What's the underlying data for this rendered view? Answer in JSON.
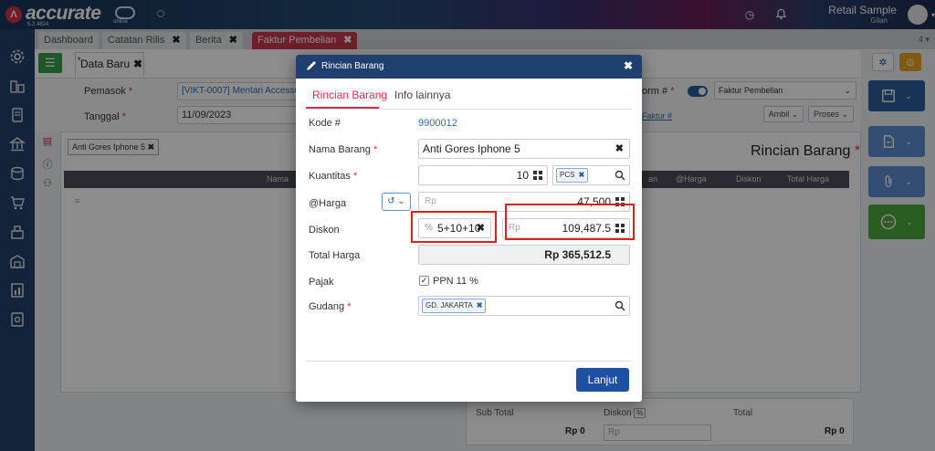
{
  "topbar": {
    "logo": "accurate",
    "logo_sub": "online",
    "version": "5.2.4824",
    "user_name": "Retail Sample",
    "user_sub": "Gilan"
  },
  "tabs": [
    {
      "label": "Dashboard"
    },
    {
      "label": "Catatan Rilis",
      "close": "✖"
    },
    {
      "label": "Berita",
      "close": "✖"
    },
    {
      "label": "Faktur Pembelian",
      "close": "✖",
      "active": true
    }
  ],
  "tab_count": "4",
  "subtab": {
    "label": "Data Baru",
    "close": "✖"
  },
  "form": {
    "pemasok_label": "Pemasok",
    "pemasok_value": "[VIKT-0007] Mentari Accessories",
    "tanggal_label": "Tanggal",
    "tanggal_value": "11/09/2023",
    "form_label": "orm #",
    "form_value": "Faktur Pembelian",
    "faktur_link": "Faktur #",
    "ambil_label": "Ambil",
    "proses_label": "Proses"
  },
  "detail": {
    "title": "Rincian Barang",
    "chip": "Anti Gores Iphone 5",
    "columns": [
      "Nama",
      "an",
      "@Harga",
      "Diskon",
      "Total Harga"
    ]
  },
  "totals": {
    "subtotal_label": "Sub Total",
    "subtotal_value": "Rp 0",
    "diskon_label": "Diskon",
    "diskon_rp": "Rp",
    "total_label": "Total",
    "total_value": "Rp 0"
  },
  "modal": {
    "title": "Rincian Barang",
    "close": "✖",
    "tabs": [
      {
        "label": "Rincian Barang"
      },
      {
        "label": "Info lainnya"
      }
    ],
    "kode_label": "Kode #",
    "kode_value": "9900012",
    "nama_label": "Nama Barang",
    "nama_value": "Anti Gores Iphone 5",
    "kuantitas_label": "Kuantitas",
    "kuantitas_value": "10",
    "unit_chip": "PCS",
    "harga_label": "@Harga",
    "harga_prefix": "Rp",
    "harga_value": "47,500",
    "diskon_label": "Diskon",
    "diskon_pct_prefix": "%",
    "diskon_pct_value": "5+10+10",
    "diskon_rp_prefix": "Rp",
    "diskon_rp_value": "109,487.5",
    "total_label": "Total Harga",
    "total_value": "Rp 365,512.5",
    "pajak_label": "Pajak",
    "ppn_label": "PPN 11 %",
    "gudang_label": "Gudang",
    "gudang_chip": "GD. JAKARTA",
    "lanjut_label": "Lanjut"
  },
  "colors": {
    "accent_red": "#d9304a",
    "primary_blue": "#1f4fa0",
    "sidebar": "#24426a",
    "highlight_box": "#e02020"
  }
}
